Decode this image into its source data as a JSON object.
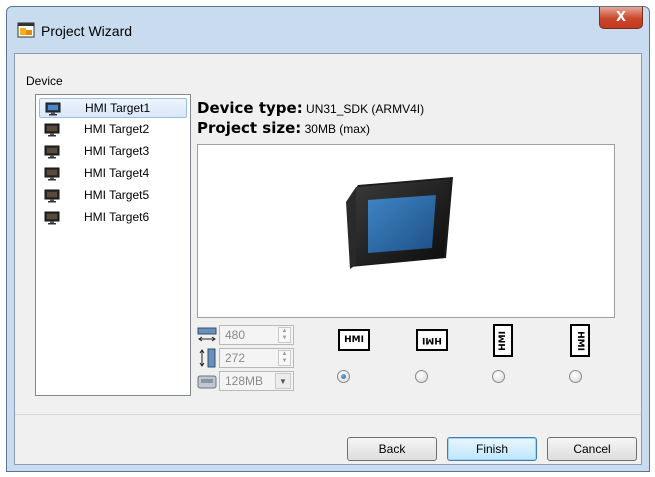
{
  "window": {
    "title": "Project Wizard",
    "close_glyph": "X"
  },
  "device_section": {
    "label": "Device"
  },
  "devices": [
    {
      "label": "HMI Target1",
      "selected": true
    },
    {
      "label": "HMI Target2",
      "selected": false
    },
    {
      "label": "HMI Target3",
      "selected": false
    },
    {
      "label": "HMI Target4",
      "selected": false
    },
    {
      "label": "HMI Target5",
      "selected": false
    },
    {
      "label": "HMI Target6",
      "selected": false
    }
  ],
  "info": {
    "device_type_label": "Device type:",
    "device_type_value": "UN31_SDK (ARMV4I)",
    "project_size_label": "Project size:",
    "project_size_value": "30MB (max)"
  },
  "settings": {
    "width": "480",
    "height": "272",
    "memory": "128MB"
  },
  "orientations": [
    {
      "label": "HMI",
      "checked": true
    },
    {
      "label": "HMI",
      "checked": false
    },
    {
      "label": "HMI",
      "checked": false
    },
    {
      "label": "HMI",
      "checked": false
    }
  ],
  "buttons": {
    "back": "Back",
    "finish": "Finish",
    "cancel": "Cancel"
  },
  "colors": {
    "accent": "#3c7fb1",
    "close": "#c9462b",
    "frame": "#c9dbee"
  }
}
